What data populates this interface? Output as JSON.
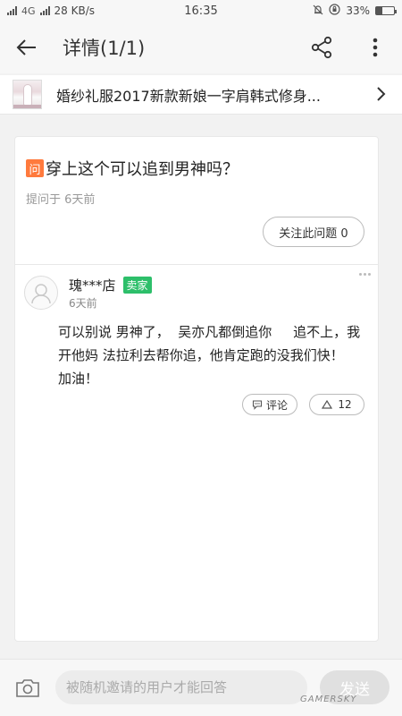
{
  "status_bar": {
    "network": "4G",
    "speed": "28 KB/s",
    "time": "16:35",
    "battery": "33%",
    "battery_level": 0.33
  },
  "nav": {
    "title": "详情(1/1)"
  },
  "product": {
    "title": "婚纱礼服2017新款新娘一字肩韩式修身..."
  },
  "question": {
    "badge": "问",
    "text": "穿上这个可以追到男神吗？",
    "meta": "提问于 6天前",
    "follow_label": "关注此问题 0"
  },
  "answer": {
    "name": "瑰***店",
    "badge": "卖家",
    "time": "6天前",
    "body": "可以别说 男神了，  吴亦凡都倒追你     追不上，我开他妈 法拉利去帮你追，他肯定跑的没我们快！           加油！",
    "comment_label": "评论",
    "like_count": "12"
  },
  "bottom": {
    "input_placeholder": "被随机邀请的用户才能回答",
    "send_label": "发送"
  },
  "watermark": "GAMERSKY",
  "colors": {
    "question_badge": "#ff7a3d",
    "seller_badge": "#2dbf6a"
  }
}
